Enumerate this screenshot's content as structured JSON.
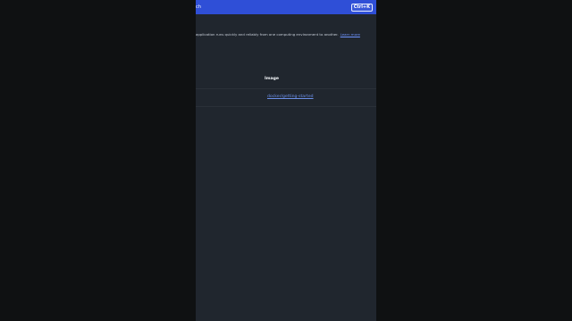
{
  "header": {
    "search_partial": "ch",
    "shortcut_label": "Ctrl+K"
  },
  "intro": {
    "text": "application runs quickly and reliably from one computing environment to another.",
    "learn_more": "Learn more"
  },
  "table": {
    "column_header": "Image",
    "rows": [
      {
        "image_link": "docker/getting-started"
      }
    ]
  },
  "colors": {
    "header_blue": "#2f4fd7",
    "panel_bg": "#20262e",
    "link_blue": "#6b8fe8"
  }
}
